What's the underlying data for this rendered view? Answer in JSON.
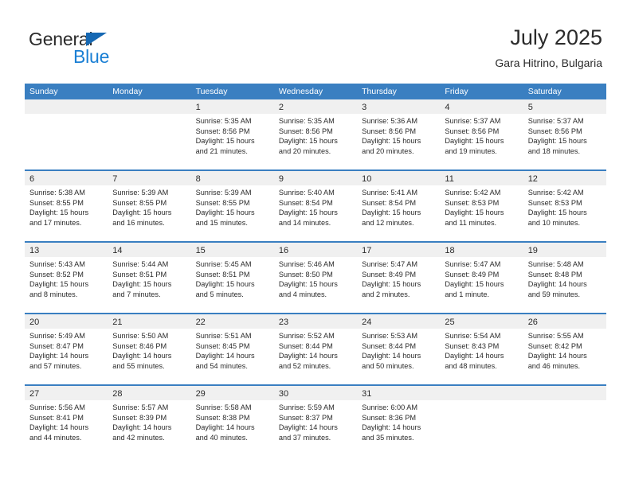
{
  "brand": {
    "word1": "General",
    "word2": "Blue",
    "triangle_color": "#1668b3",
    "blue_text_color": "#1a7fd4"
  },
  "header": {
    "title": "July 2025",
    "subtitle": "Gara Hitrino, Bulgaria"
  },
  "theme": {
    "header_blue": "#3a7fc1",
    "row_divider_blue": "#3a7fc1",
    "day_band_gray": "#f0f0f0",
    "text_color": "#2b2b2b"
  },
  "calendar": {
    "weekdays": [
      "Sunday",
      "Monday",
      "Tuesday",
      "Wednesday",
      "Thursday",
      "Friday",
      "Saturday"
    ],
    "weeks": [
      [
        {
          "day": "",
          "lines": []
        },
        {
          "day": "",
          "lines": []
        },
        {
          "day": "1",
          "lines": [
            "Sunrise: 5:35 AM",
            "Sunset: 8:56 PM",
            "Daylight: 15 hours",
            "and 21 minutes."
          ]
        },
        {
          "day": "2",
          "lines": [
            "Sunrise: 5:35 AM",
            "Sunset: 8:56 PM",
            "Daylight: 15 hours",
            "and 20 minutes."
          ]
        },
        {
          "day": "3",
          "lines": [
            "Sunrise: 5:36 AM",
            "Sunset: 8:56 PM",
            "Daylight: 15 hours",
            "and 20 minutes."
          ]
        },
        {
          "day": "4",
          "lines": [
            "Sunrise: 5:37 AM",
            "Sunset: 8:56 PM",
            "Daylight: 15 hours",
            "and 19 minutes."
          ]
        },
        {
          "day": "5",
          "lines": [
            "Sunrise: 5:37 AM",
            "Sunset: 8:56 PM",
            "Daylight: 15 hours",
            "and 18 minutes."
          ]
        }
      ],
      [
        {
          "day": "6",
          "lines": [
            "Sunrise: 5:38 AM",
            "Sunset: 8:55 PM",
            "Daylight: 15 hours",
            "and 17 minutes."
          ]
        },
        {
          "day": "7",
          "lines": [
            "Sunrise: 5:39 AM",
            "Sunset: 8:55 PM",
            "Daylight: 15 hours",
            "and 16 minutes."
          ]
        },
        {
          "day": "8",
          "lines": [
            "Sunrise: 5:39 AM",
            "Sunset: 8:55 PM",
            "Daylight: 15 hours",
            "and 15 minutes."
          ]
        },
        {
          "day": "9",
          "lines": [
            "Sunrise: 5:40 AM",
            "Sunset: 8:54 PM",
            "Daylight: 15 hours",
            "and 14 minutes."
          ]
        },
        {
          "day": "10",
          "lines": [
            "Sunrise: 5:41 AM",
            "Sunset: 8:54 PM",
            "Daylight: 15 hours",
            "and 12 minutes."
          ]
        },
        {
          "day": "11",
          "lines": [
            "Sunrise: 5:42 AM",
            "Sunset: 8:53 PM",
            "Daylight: 15 hours",
            "and 11 minutes."
          ]
        },
        {
          "day": "12",
          "lines": [
            "Sunrise: 5:42 AM",
            "Sunset: 8:53 PM",
            "Daylight: 15 hours",
            "and 10 minutes."
          ]
        }
      ],
      [
        {
          "day": "13",
          "lines": [
            "Sunrise: 5:43 AM",
            "Sunset: 8:52 PM",
            "Daylight: 15 hours",
            "and 8 minutes."
          ]
        },
        {
          "day": "14",
          "lines": [
            "Sunrise: 5:44 AM",
            "Sunset: 8:51 PM",
            "Daylight: 15 hours",
            "and 7 minutes."
          ]
        },
        {
          "day": "15",
          "lines": [
            "Sunrise: 5:45 AM",
            "Sunset: 8:51 PM",
            "Daylight: 15 hours",
            "and 5 minutes."
          ]
        },
        {
          "day": "16",
          "lines": [
            "Sunrise: 5:46 AM",
            "Sunset: 8:50 PM",
            "Daylight: 15 hours",
            "and 4 minutes."
          ]
        },
        {
          "day": "17",
          "lines": [
            "Sunrise: 5:47 AM",
            "Sunset: 8:49 PM",
            "Daylight: 15 hours",
            "and 2 minutes."
          ]
        },
        {
          "day": "18",
          "lines": [
            "Sunrise: 5:47 AM",
            "Sunset: 8:49 PM",
            "Daylight: 15 hours",
            "and 1 minute."
          ]
        },
        {
          "day": "19",
          "lines": [
            "Sunrise: 5:48 AM",
            "Sunset: 8:48 PM",
            "Daylight: 14 hours",
            "and 59 minutes."
          ]
        }
      ],
      [
        {
          "day": "20",
          "lines": [
            "Sunrise: 5:49 AM",
            "Sunset: 8:47 PM",
            "Daylight: 14 hours",
            "and 57 minutes."
          ]
        },
        {
          "day": "21",
          "lines": [
            "Sunrise: 5:50 AM",
            "Sunset: 8:46 PM",
            "Daylight: 14 hours",
            "and 55 minutes."
          ]
        },
        {
          "day": "22",
          "lines": [
            "Sunrise: 5:51 AM",
            "Sunset: 8:45 PM",
            "Daylight: 14 hours",
            "and 54 minutes."
          ]
        },
        {
          "day": "23",
          "lines": [
            "Sunrise: 5:52 AM",
            "Sunset: 8:44 PM",
            "Daylight: 14 hours",
            "and 52 minutes."
          ]
        },
        {
          "day": "24",
          "lines": [
            "Sunrise: 5:53 AM",
            "Sunset: 8:44 PM",
            "Daylight: 14 hours",
            "and 50 minutes."
          ]
        },
        {
          "day": "25",
          "lines": [
            "Sunrise: 5:54 AM",
            "Sunset: 8:43 PM",
            "Daylight: 14 hours",
            "and 48 minutes."
          ]
        },
        {
          "day": "26",
          "lines": [
            "Sunrise: 5:55 AM",
            "Sunset: 8:42 PM",
            "Daylight: 14 hours",
            "and 46 minutes."
          ]
        }
      ],
      [
        {
          "day": "27",
          "lines": [
            "Sunrise: 5:56 AM",
            "Sunset: 8:41 PM",
            "Daylight: 14 hours",
            "and 44 minutes."
          ]
        },
        {
          "day": "28",
          "lines": [
            "Sunrise: 5:57 AM",
            "Sunset: 8:39 PM",
            "Daylight: 14 hours",
            "and 42 minutes."
          ]
        },
        {
          "day": "29",
          "lines": [
            "Sunrise: 5:58 AM",
            "Sunset: 8:38 PM",
            "Daylight: 14 hours",
            "and 40 minutes."
          ]
        },
        {
          "day": "30",
          "lines": [
            "Sunrise: 5:59 AM",
            "Sunset: 8:37 PM",
            "Daylight: 14 hours",
            "and 37 minutes."
          ]
        },
        {
          "day": "31",
          "lines": [
            "Sunrise: 6:00 AM",
            "Sunset: 8:36 PM",
            "Daylight: 14 hours",
            "and 35 minutes."
          ]
        },
        {
          "day": "",
          "lines": []
        },
        {
          "day": "",
          "lines": []
        }
      ]
    ]
  }
}
